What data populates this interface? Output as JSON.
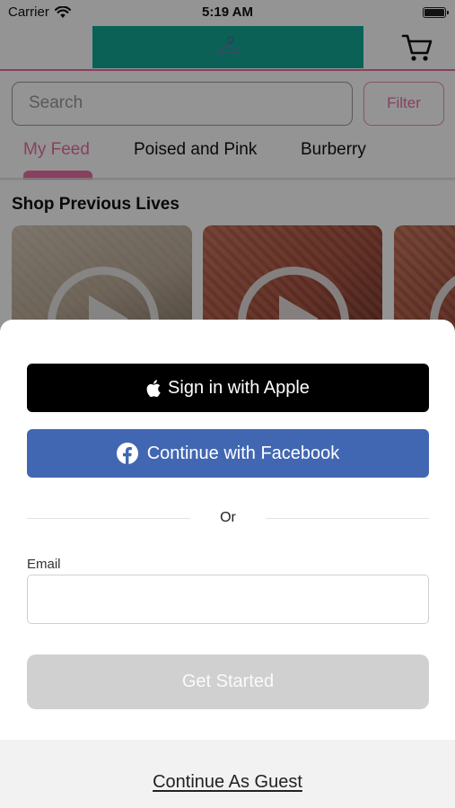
{
  "status_bar": {
    "carrier": "Carrier",
    "time": "5:19 AM",
    "wifi_icon": "wifi-icon",
    "battery_icon": "battery-icon"
  },
  "header": {
    "logo_color": "#13a795",
    "accent_color": "#e86ea4",
    "cart_icon": "cart-icon"
  },
  "search": {
    "placeholder": "Search",
    "filter_label": "Filter"
  },
  "tabs": [
    {
      "label": "My Feed",
      "active": true
    },
    {
      "label": "Poised and Pink",
      "active": false
    },
    {
      "label": "Burberry",
      "active": false
    }
  ],
  "section": {
    "title": "Shop Previous Lives",
    "videos": [
      {
        "icon": "play-icon"
      },
      {
        "icon": "play-icon"
      },
      {
        "icon": "play-icon"
      }
    ]
  },
  "sheet": {
    "apple_button": "Sign in with Apple",
    "apple_icon": "apple-icon",
    "facebook_button": "Continue with Facebook",
    "facebook_icon": "facebook-icon",
    "facebook_color": "#4267b2",
    "divider_text": "Or",
    "email_label": "Email",
    "email_value": "",
    "submit_button": "Get Started",
    "guest_link": "Continue As Guest"
  }
}
